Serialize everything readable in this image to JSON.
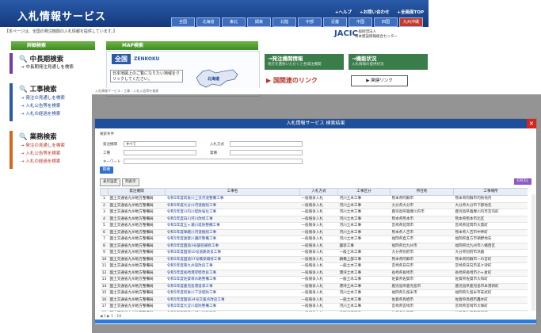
{
  "portal": {
    "logo": "入札情報サービス",
    "top_links": [
      "+ヘルプ",
      "+お問い合わせ",
      "+全画面TOP"
    ],
    "regions": [
      "全国",
      "北海道",
      "東北",
      "関東",
      "北陸",
      "中部",
      "近畿",
      "中国",
      "四国",
      "九州沖縄"
    ],
    "notice": "【本ページは、全国の発注機関の入札情報を提供しています。】",
    "jacic": "JACIC",
    "jacic_sub": "一般財団法人\n日本建設情報総合センター",
    "detail_header": "詳細検索",
    "map_header": "MAP検索",
    "sections": [
      {
        "title": "中長期検索",
        "links": [
          "中長期発注見通しを検索"
        ]
      },
      {
        "title": "工事検索",
        "links": [
          "発注の見通しを検索",
          "入札公告等を検索",
          "入札の経過を検索"
        ]
      },
      {
        "title": "業務検索",
        "links": [
          "発注の見通しを検索",
          "入札公告等を検索",
          "入札の経過を検索"
        ]
      }
    ],
    "zenkoku_badge": "全国",
    "zenkoku_text": "ZENKOKU",
    "map_note": "日本地図上のご覧になりたい地域をクリックしてください。",
    "hokkaido": "北海道",
    "promo1_title": "→発注機関情報",
    "promo1_sub": "地方を選択いただくと各発注機関",
    "promo2_title": "→機能状況",
    "promo2_sub": "入札情報の提供状況",
    "kokudo": "▶ 国関連のリンク",
    "link_button": "関連リンク",
    "subbar": "入札情報サービス › 工事 › 入札公告等を検索"
  },
  "modal": {
    "title": "入札情報サービス 検索結果",
    "close": "×",
    "form_title": "検索条件",
    "fields": [
      {
        "label": "発注機関",
        "value": "すべて"
      },
      {
        "label": "入札方式",
        "value": ""
      },
      {
        "label": "工種",
        "value": ""
      },
      {
        "label": "業種",
        "value": ""
      },
      {
        "label": "キーワード",
        "value": ""
      }
    ],
    "search_button": "検索",
    "toolbar": [
      "表示設定",
      "列表示"
    ],
    "excel_button": "EXCEL",
    "columns": [
      "",
      "発注機関",
      "工事名",
      "入札方式",
      "工事区分",
      "所在地",
      "工事場所"
    ],
    "rows": [
      [
        "1",
        "国土交通省九州地方整備局",
        "令和5年度筑後川上流河道整備工事",
        "一般競争入札",
        "河川土木工事",
        "熊本県阿蘇市",
        "熊本県阿蘇市内牧地内"
      ],
      [
        "2",
        "国土交通省九州地方整備局",
        "令和5年度大分川河道掘削工事",
        "一般競争入札",
        "河川土木工事",
        "大分県大分市",
        "大分県大分市下郡地先"
      ],
      [
        "3",
        "国土交通省九州地方整備局",
        "令和5年度川内川堤防強化工事",
        "一般競争入札",
        "河川土木工事",
        "鹿児島県薩摩川内市",
        "鹿児島県薩摩川内市宮内町"
      ],
      [
        "4",
        "国土交通省九州地方整備局",
        "令和5年度白川河川改修工事",
        "一般競争入札",
        "河川土木工事",
        "熊本県熊本市",
        "熊本県熊本市北区"
      ],
      [
        "5",
        "国土交通省九州地方整備局",
        "令和5年度五ヶ瀬川堤防整備工事",
        "一般競争入札",
        "河川土木工事",
        "宮崎県延岡市",
        "宮崎県延岡市大貫町"
      ],
      [
        "6",
        "国土交通省九州地方整備局",
        "令和5年度球磨川河道掘削工事",
        "一般競争入札",
        "河川土木工事",
        "熊本県人吉市",
        "熊本県人吉市中神町"
      ],
      [
        "7",
        "国土交通省九州地方整備局",
        "令和5年度遠賀川護岸整備工事",
        "一般競争入札",
        "河川土木工事",
        "福岡県直方市",
        "福岡県直方市頓野地先"
      ],
      [
        "8",
        "国土交通省九州地方整備局",
        "令和5年度国道3号舗装補修工事",
        "一般競争入札",
        "舗装工事",
        "福岡県北九州市",
        "福岡県北九州市八幡西区"
      ],
      [
        "9",
        "国土交通省九州地方整備局",
        "令和5年度国道10号道路改良工事",
        "一般競争入札",
        "一般土木工事",
        "大分県別府市",
        "大分県別府市浜脇"
      ],
      [
        "10",
        "国土交通省九州地方整備局",
        "令和5年度国道57号橋梁補修工事",
        "一般競争入札",
        "鋼橋上部工事",
        "熊本県阿蘇市",
        "熊本県阿蘇市一の宮町"
      ],
      [
        "11",
        "国土交通省九州地方整備局",
        "令和5年度東九州道改良工事",
        "一般競争入札",
        "一般土木工事",
        "宮崎県日向市",
        "宮崎県日向市美々津町"
      ],
      [
        "12",
        "国土交通省九州地方整備局",
        "令和5年度長崎港岸壁改良工事",
        "一般競争入札",
        "港湾土木工事",
        "長崎県長崎市",
        "長崎県長崎市小ヶ倉町"
      ],
      [
        "13",
        "国土交通省九州地方整備局",
        "令和5年度佐賀導水路整備工事",
        "一般競争入札",
        "一般土木工事",
        "佐賀県佐賀市",
        "佐賀県佐賀市大和町"
      ],
      [
        "14",
        "国土交通省九州地方整備局",
        "令和5年度鹿児島港浚渫工事",
        "一般競争入札",
        "港湾土木工事",
        "鹿児島県鹿児島市",
        "鹿児島県鹿児島市本港新町"
      ],
      [
        "15",
        "国土交通省九州地方整備局",
        "令和5年度筑後川下流堤防工事",
        "一般競争入札",
        "河川土木工事",
        "福岡県久留米市",
        "福岡県久留米市安武町"
      ],
      [
        "16",
        "国土交通省九州地方整備局",
        "令和5年度国道34号交差点改良工事",
        "一般競争入札",
        "一般土木工事",
        "佐賀県鳥栖市",
        "佐賀県鳥栖市轟木町"
      ],
      [
        "17",
        "国土交通省九州地方整備局",
        "令和5年度大淀川堤防整備工事",
        "一般競争入札",
        "河川土木工事",
        "宮崎県宮崎市",
        "宮崎県宮崎市大塚町"
      ],
      [
        "18",
        "国土交通省九州地方整備局",
        "令和5年度嘉瀬川河川維持工事",
        "一般競争入札",
        "維持修繕工事",
        "佐賀県佐賀市",
        "佐賀県佐賀市嘉瀬町"
      ],
      [
        "19",
        "国土交通省九州地方整備局",
        "令和5年度国道220号防災工事",
        "一般競争入札",
        "一般土木工事",
        "鹿児島県霧島市",
        "鹿児島県霧島市隼人町"
      ]
    ],
    "pager": "◀  1  ▶  1 - 19"
  }
}
